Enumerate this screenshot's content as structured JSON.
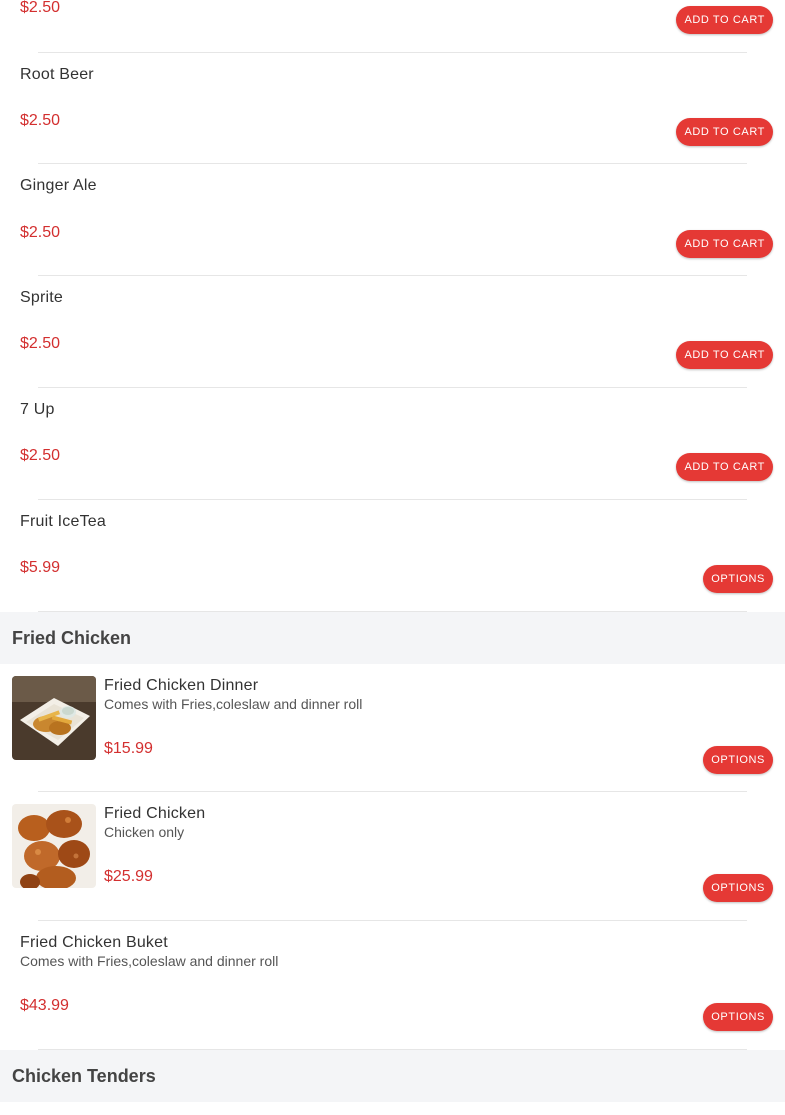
{
  "colors": {
    "accent": "#e53935",
    "price": "#d32f2f",
    "section_bg": "#f4f5f7"
  },
  "top_item": {
    "price": "$2.50",
    "button": "ADD TO CART"
  },
  "drinks": [
    {
      "name": "Root Beer",
      "price": "$2.50",
      "button": "ADD TO CART"
    },
    {
      "name": "Ginger Ale",
      "price": "$2.50",
      "button": "ADD TO CART"
    },
    {
      "name": "Sprite",
      "price": "$2.50",
      "button": "ADD TO CART"
    },
    {
      "name": "7 Up",
      "price": "$2.50",
      "button": "ADD TO CART"
    },
    {
      "name": "Fruit IceTea",
      "price": "$5.99",
      "button": "OPTIONS"
    }
  ],
  "sections": {
    "fried_chicken": {
      "title": "Fried Chicken",
      "items": [
        {
          "name": "Fried Chicken Dinner",
          "description": "Comes with Fries,coleslaw and dinner roll",
          "price": "$15.99",
          "button": "OPTIONS",
          "image": "fried-chicken-dinner-photo"
        },
        {
          "name": "Fried Chicken",
          "description": "Chicken only",
          "price": "$25.99",
          "button": "OPTIONS",
          "image": "fried-chicken-photo"
        },
        {
          "name": "Fried Chicken Buket",
          "description": "Comes with Fries,coleslaw and dinner roll",
          "price": "$43.99",
          "button": "OPTIONS"
        }
      ]
    },
    "chicken_tenders": {
      "title": "Chicken Tenders"
    }
  }
}
